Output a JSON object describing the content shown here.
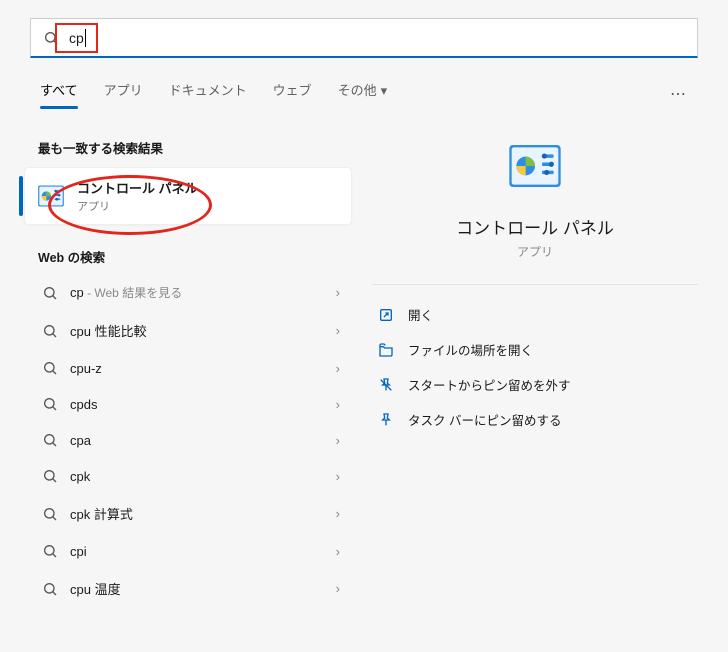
{
  "search": {
    "query": "cp"
  },
  "tabs": {
    "all": "すべて",
    "apps": "アプリ",
    "documents": "ドキュメント",
    "web": "ウェブ",
    "other": "その他"
  },
  "left": {
    "best_match_header": "最も一致する検索結果",
    "best_match": {
      "title": "コントロール パネル",
      "subtitle": "アプリ"
    },
    "web_search_header": "Web の検索",
    "suggestions": [
      {
        "term": "cp",
        "hint": " - Web 結果を見る"
      },
      {
        "term": "cpu 性能比較",
        "hint": ""
      },
      {
        "term": "cpu-z",
        "hint": ""
      },
      {
        "term": "cpds",
        "hint": ""
      },
      {
        "term": "cpa",
        "hint": ""
      },
      {
        "term": "cpk",
        "hint": ""
      },
      {
        "term": "cpk 計算式",
        "hint": ""
      },
      {
        "term": "cpi",
        "hint": ""
      },
      {
        "term": "cpu 温度",
        "hint": ""
      }
    ]
  },
  "preview": {
    "title": "コントロール パネル",
    "subtitle": "アプリ",
    "actions": {
      "open": "開く",
      "open_location": "ファイルの場所を開く",
      "unpin_start": "スタートからピン留めを外す",
      "pin_taskbar": "タスク バーにピン留めする"
    }
  }
}
